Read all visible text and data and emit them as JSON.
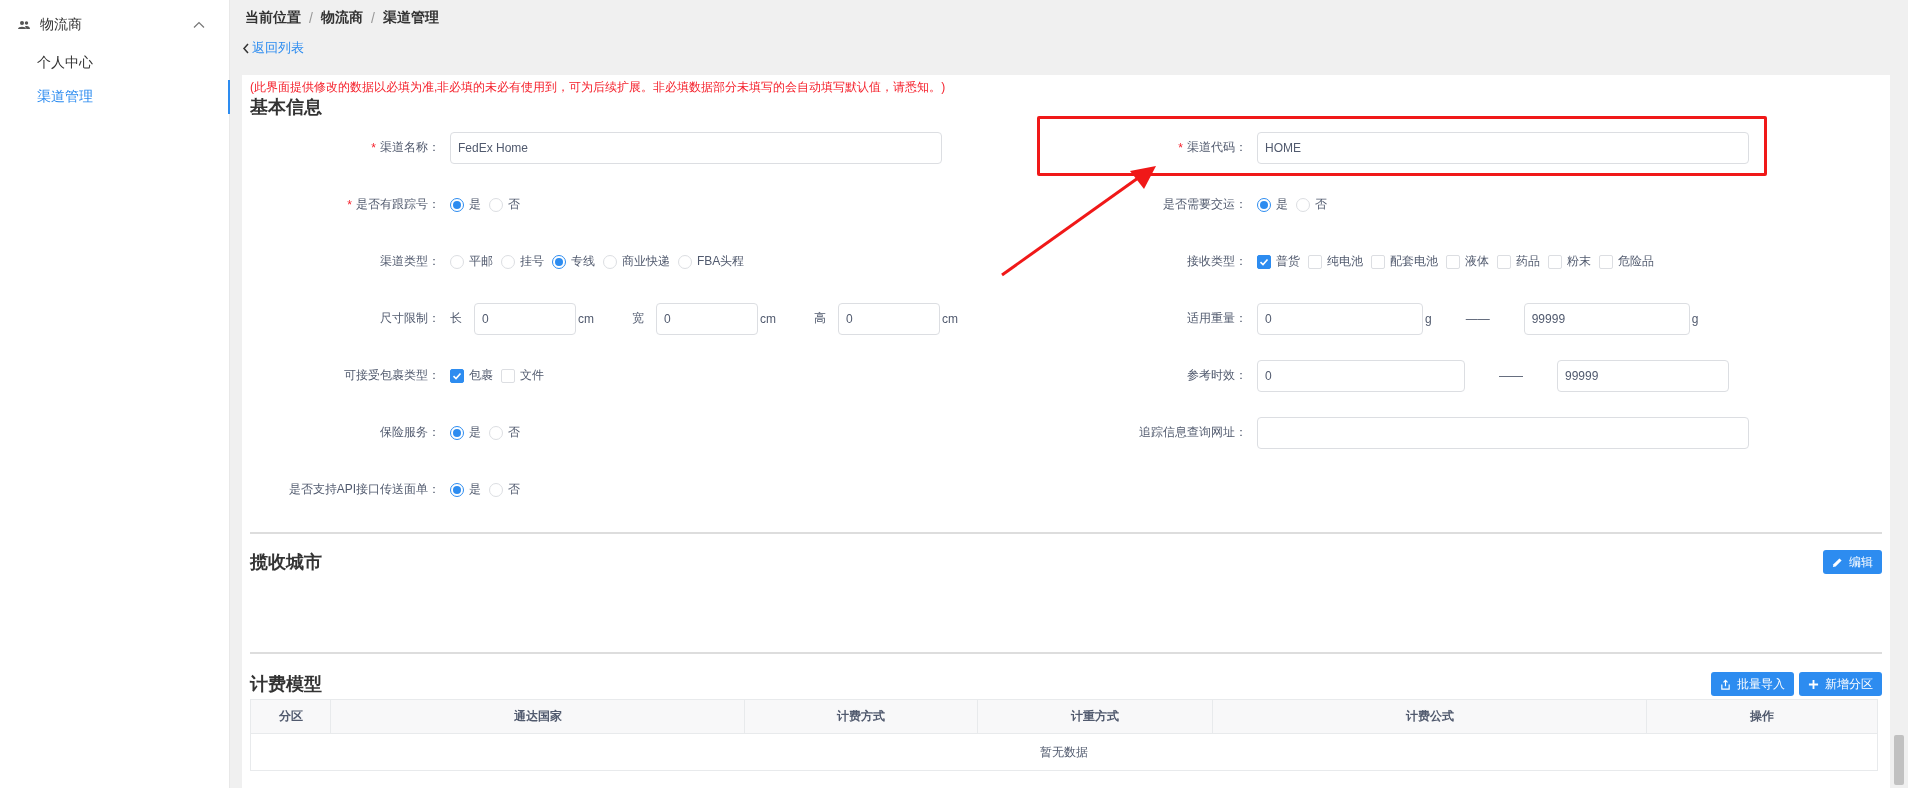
{
  "sidebar": {
    "group": {
      "label": "物流商",
      "expanded": true
    },
    "items": [
      {
        "label": "个人中心",
        "selected": false
      },
      {
        "label": "渠道管理",
        "selected": true
      }
    ]
  },
  "breadcrumb": {
    "separator": "/",
    "items": [
      "当前位置",
      "物流商",
      "渠道管理"
    ]
  },
  "back_link": "返回列表",
  "notice": "(此界面提供修改的数据以必填为准,非必填的未必有使用到，可为后续扩展。非必填数据部分未填写的会自动填写默认值，请悉知。)",
  "basic_info": {
    "title": "基本信息",
    "left_fields": [
      {
        "kind": "text",
        "label": "渠道名称：",
        "required_mark": "*",
        "value": "FedEx Home"
      },
      {
        "kind": "radio",
        "label": "是否有跟踪号：",
        "required_mark": "*",
        "options": [
          {
            "label": "是",
            "selected": true
          },
          {
            "label": "否",
            "selected": false
          }
        ]
      },
      {
        "kind": "radio",
        "label": "渠道类型：",
        "options": [
          {
            "label": "平邮",
            "selected": false
          },
          {
            "label": "挂号",
            "selected": false
          },
          {
            "label": "专线",
            "selected": true
          },
          {
            "label": "商业快递",
            "selected": false
          },
          {
            "label": "FBA头程",
            "selected": false
          }
        ]
      },
      {
        "kind": "dimensions",
        "label": "尺寸限制：",
        "parts": [
          {
            "label": "长",
            "value": "0",
            "unit": "cm"
          },
          {
            "label": "宽",
            "value": "0",
            "unit": "cm"
          },
          {
            "label": "高",
            "value": "0",
            "unit": "cm"
          }
        ]
      },
      {
        "kind": "checkbox",
        "label": "可接受包裹类型：",
        "options": [
          {
            "label": "包裹",
            "checked": true
          },
          {
            "label": "文件",
            "checked": false
          }
        ]
      },
      {
        "kind": "radio",
        "label": "保险服务：",
        "options": [
          {
            "label": "是",
            "selected": true
          },
          {
            "label": "否",
            "selected": false
          }
        ]
      },
      {
        "kind": "radio",
        "label": "是否支持API接口传送面单：",
        "options": [
          {
            "label": "是",
            "selected": true
          },
          {
            "label": "否",
            "selected": false
          }
        ]
      }
    ],
    "right_fields": [
      {
        "kind": "text",
        "label": "渠道代码：",
        "required_mark": "*",
        "value": "HOME",
        "highlighted": true
      },
      {
        "kind": "radio",
        "label": "是否需要交运：",
        "options": [
          {
            "label": "是",
            "selected": true
          },
          {
            "label": "否",
            "selected": false
          }
        ]
      },
      {
        "kind": "checkbox",
        "label": "接收类型：",
        "options": [
          {
            "label": "普货",
            "checked": true
          },
          {
            "label": "纯电池",
            "checked": false
          },
          {
            "label": "配套电池",
            "checked": false
          },
          {
            "label": "液体",
            "checked": false
          },
          {
            "label": "药品",
            "checked": false
          },
          {
            "label": "粉末",
            "checked": false
          },
          {
            "label": "危险品",
            "checked": false
          }
        ]
      },
      {
        "kind": "range",
        "label": "适用重量：",
        "from": {
          "value": "0",
          "unit": "g"
        },
        "separator": "——",
        "to": {
          "value": "99999",
          "unit": "g"
        }
      },
      {
        "kind": "range",
        "label": "参考时效：",
        "from": {
          "value": "0"
        },
        "separator": "——",
        "to": {
          "value": "99999"
        }
      },
      {
        "kind": "text",
        "label": "追踪信息查询网址："
      }
    ]
  },
  "pickup_cities": {
    "title": "揽收城市",
    "buttons": [
      {
        "kind": "edit",
        "label": "编辑"
      }
    ]
  },
  "billing_model": {
    "title": "计费模型",
    "buttons": [
      {
        "kind": "import",
        "label": "批量导入"
      },
      {
        "kind": "add",
        "label": "新增分区"
      }
    ],
    "table": {
      "columns": [
        "分区",
        "通达国家",
        "计费方式",
        "计重方式",
        "计费公式",
        "操作"
      ],
      "empty_text": "暂无数据"
    }
  }
}
